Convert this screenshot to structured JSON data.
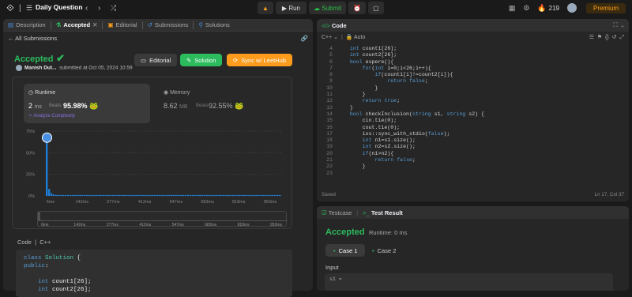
{
  "topbar": {
    "title": "Daily Question",
    "run": "Run",
    "submit": "Submit",
    "streak": "219",
    "premium": "Premium"
  },
  "left": {
    "tabs": [
      "Description",
      "Accepted",
      "Editorial",
      "Submissions",
      "Solutions"
    ],
    "all_submissions": "All Submissions",
    "status": "Accepted",
    "user": "Manish Dut...",
    "submitted": "submitted at Oct 05, 2024 10:59",
    "buttons": {
      "editorial": "Editorial",
      "solution": "Solution",
      "sync": "Sync w/ LeetHub"
    },
    "runtime": {
      "label": "Runtime",
      "value": "2",
      "unit": "ms",
      "beats_label": "Beats",
      "beats": "95.98%",
      "analyze": "Analyze Complexity"
    },
    "memory": {
      "label": "Memory",
      "value": "8.62",
      "unit": "MB",
      "beats_label": "Beats",
      "beats": "92.55%"
    },
    "code_tab": "Code",
    "code_lang": "C++",
    "code_lines": [
      "class Solution {",
      "public:",
      "",
      "    int count1[26];",
      "    int count2[26];"
    ]
  },
  "chart_data": {
    "type": "bar",
    "y_ticks": [
      "75%",
      "50%",
      "25%",
      "0%"
    ],
    "x_ticks": [
      "6ms",
      "142ms",
      "277ms",
      "412ms",
      "547ms",
      "683ms",
      "818ms",
      "953ms"
    ],
    "scrub_ticks": [
      "6ms",
      "142ms",
      "277ms",
      "412ms",
      "547ms",
      "683ms",
      "818ms",
      "953ms"
    ],
    "ylim": [
      0,
      75
    ],
    "values": [
      72,
      8,
      3,
      1.5,
      1.2,
      1,
      1,
      1,
      1,
      1,
      1,
      1,
      1,
      1,
      1,
      1,
      1,
      1,
      1,
      1,
      1,
      1,
      1,
      1,
      1,
      1,
      1,
      1,
      1,
      1,
      1,
      1,
      1,
      1,
      1,
      1,
      1,
      1,
      1,
      1,
      1,
      1,
      1,
      1,
      1,
      1,
      1,
      1,
      1,
      1,
      1,
      1,
      1,
      1,
      1,
      1,
      1,
      1,
      1,
      1,
      1,
      1,
      1,
      1,
      1,
      1,
      1,
      1,
      1,
      1,
      1,
      1,
      1,
      1,
      1,
      1,
      1,
      1,
      1,
      1,
      1,
      1,
      1,
      1,
      1,
      1,
      1,
      1,
      1,
      1,
      1,
      1,
      1,
      1,
      1,
      1,
      1,
      1,
      1,
      1
    ],
    "highlight_index": 0
  },
  "editor": {
    "title": "Code",
    "lang": "C++",
    "mode": "Auto",
    "line_numbers": [
      "4",
      "5",
      "6",
      "7",
      "8",
      "9",
      "10",
      "11",
      "12",
      "13",
      "14",
      "15",
      "16",
      "17",
      "18",
      "19",
      "20",
      "21",
      "22",
      "23"
    ],
    "lines": [
      "    int count1[26];",
      "    int count2[26];",
      "    bool espere(){",
      "        for(int i=0;i<26;i++){",
      "            if(count1[i]!=count2[i]){",
      "                return false;",
      "            }",
      "        }",
      "        return true;",
      "    }",
      "    bool checkInclusion(string s1, string s2) {",
      "        cin.tie(0);",
      "        cout.tie(0);",
      "        ios::sync_with_stdio(false);",
      "        int n1=s1.size();",
      "        int n2=s2.size();",
      "        if(n1>n2){",
      "            return false;",
      "        }",
      ""
    ],
    "saved": "Saved",
    "position": "Ln 17, Col 37"
  },
  "testpanel": {
    "tab1": "Testcase",
    "tab2": "Test Result",
    "result": "Accepted",
    "runtime": "Runtime: 0 ms",
    "case1": "Case 1",
    "case2": "Case 2",
    "input_label": "Input",
    "var": "s1 ="
  }
}
